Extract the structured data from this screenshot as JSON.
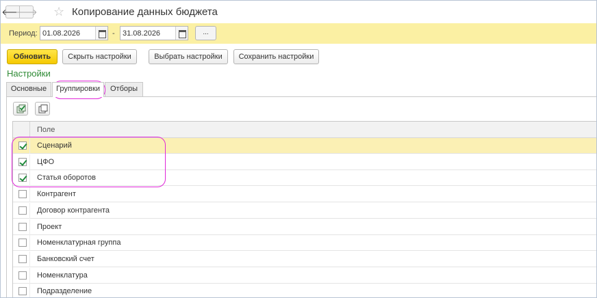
{
  "window": {
    "title": "Копирование данных бюджета",
    "back_glyph": "🡐",
    "forward_glyph": "🡒",
    "star_glyph": "☆"
  },
  "period": {
    "label": "Период:",
    "from": "01.08.2026",
    "separator": "-",
    "to": "31.08.2026",
    "more_label": "..."
  },
  "toolbar": {
    "refresh": "Обновить",
    "hide_settings": "Скрыть настройки",
    "choose_settings": "Выбрать настройки",
    "save_settings": "Сохранить настройки"
  },
  "settings": {
    "title": "Настройки",
    "tabs": [
      {
        "label": "Основные",
        "active": false
      },
      {
        "label": "Группировки",
        "active": true
      },
      {
        "label": "Отборы",
        "active": false
      }
    ]
  },
  "table": {
    "column_header": "Поле",
    "rows": [
      {
        "label": "Сценарий",
        "checked": true,
        "selected": true
      },
      {
        "label": "ЦФО",
        "checked": true,
        "selected": false
      },
      {
        "label": "Статья оборотов",
        "checked": true,
        "selected": false
      },
      {
        "label": "Контрагент",
        "checked": false,
        "selected": false
      },
      {
        "label": "Договор контрагента",
        "checked": false,
        "selected": false
      },
      {
        "label": "Проект",
        "checked": false,
        "selected": false
      },
      {
        "label": "Номенклатурная группа",
        "checked": false,
        "selected": false
      },
      {
        "label": "Банковский счет",
        "checked": false,
        "selected": false
      },
      {
        "label": "Номенклатура",
        "checked": false,
        "selected": false
      },
      {
        "label": "Подразделение",
        "checked": false,
        "selected": false
      }
    ]
  },
  "colors": {
    "accent_yellow": "#fbf0a3",
    "primary_button": "#f5c900",
    "settings_title": "#2e8a35",
    "highlight": "#e026d8",
    "check": "#1f8a3b"
  },
  "icons": [
    "back-arrow-icon",
    "forward-arrow-icon",
    "favorite-star-icon",
    "calendar-icon",
    "check-all-icon",
    "uncheck-all-icon"
  ]
}
